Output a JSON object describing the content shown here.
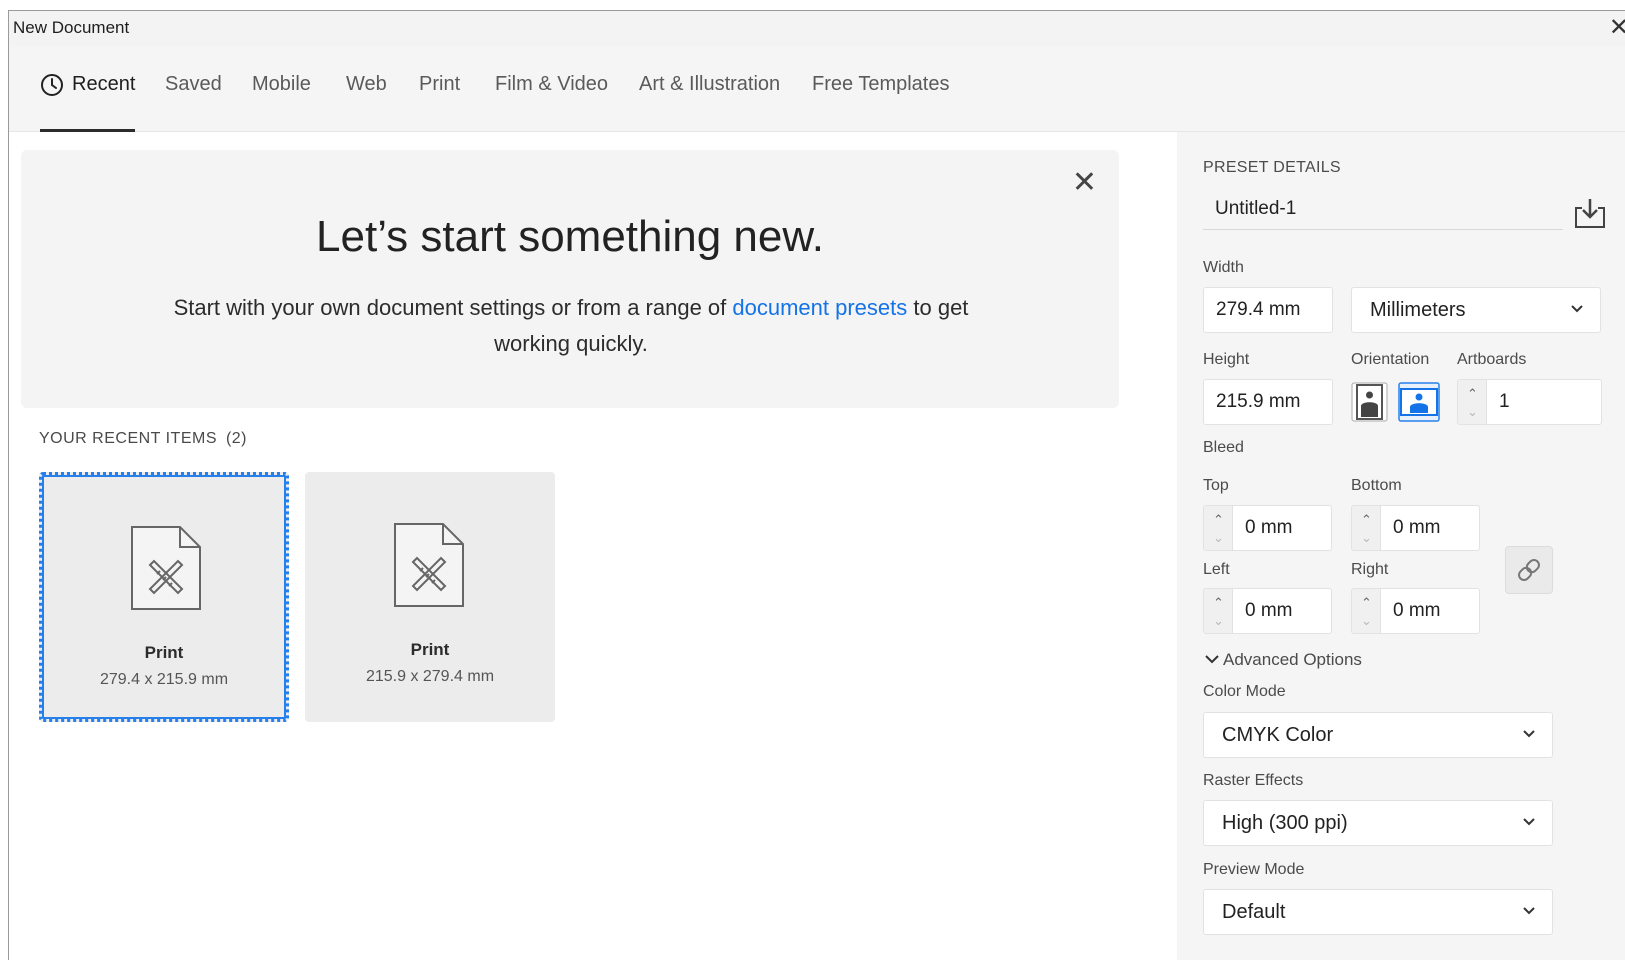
{
  "window": {
    "title": "New Document",
    "close_glyph": "✕"
  },
  "tabs": [
    {
      "label": "Recent",
      "active": true,
      "icon": "clock-icon"
    },
    {
      "label": "Saved"
    },
    {
      "label": "Mobile"
    },
    {
      "label": "Web"
    },
    {
      "label": "Print"
    },
    {
      "label": "Film & Video"
    },
    {
      "label": "Art & Illustration"
    },
    {
      "label": "Free Templates"
    }
  ],
  "banner": {
    "title": "Let’s start something new.",
    "text_before": "Start with your own document settings or from a range of ",
    "link": "document presets",
    "text_after": " to get working quickly.",
    "close_glyph": "✕"
  },
  "recent": {
    "heading": "YOUR RECENT ITEMS",
    "count": "(2)",
    "items": [
      {
        "name": "Print",
        "size": "279.4 x 215.9 mm",
        "selected": true
      },
      {
        "name": "Print",
        "size": "215.9 x 279.4 mm",
        "selected": false
      }
    ]
  },
  "preset": {
    "heading": "PRESET DETAILS",
    "name": "Untitled-1",
    "width_label": "Width",
    "width": "279.4 mm",
    "units": "Millimeters",
    "height_label": "Height",
    "height": "215.9 mm",
    "orientation_label": "Orientation",
    "orientation": "landscape",
    "artboards_label": "Artboards",
    "artboards": "1",
    "bleed_label": "Bleed",
    "top_label": "Top",
    "top": "0 mm",
    "bottom_label": "Bottom",
    "bottom": "0 mm",
    "left_label": "Left",
    "left": "0 mm",
    "right_label": "Right",
    "right": "0 mm",
    "advanced_label": "Advanced Options",
    "color_mode_label": "Color Mode",
    "color_mode": "CMYK Color",
    "raster_label": "Raster Effects",
    "raster": "High (300 ppi)",
    "preview_label": "Preview Mode",
    "preview": "Default"
  },
  "colors": {
    "accent": "#1473e6",
    "selection": "#2680eb"
  }
}
